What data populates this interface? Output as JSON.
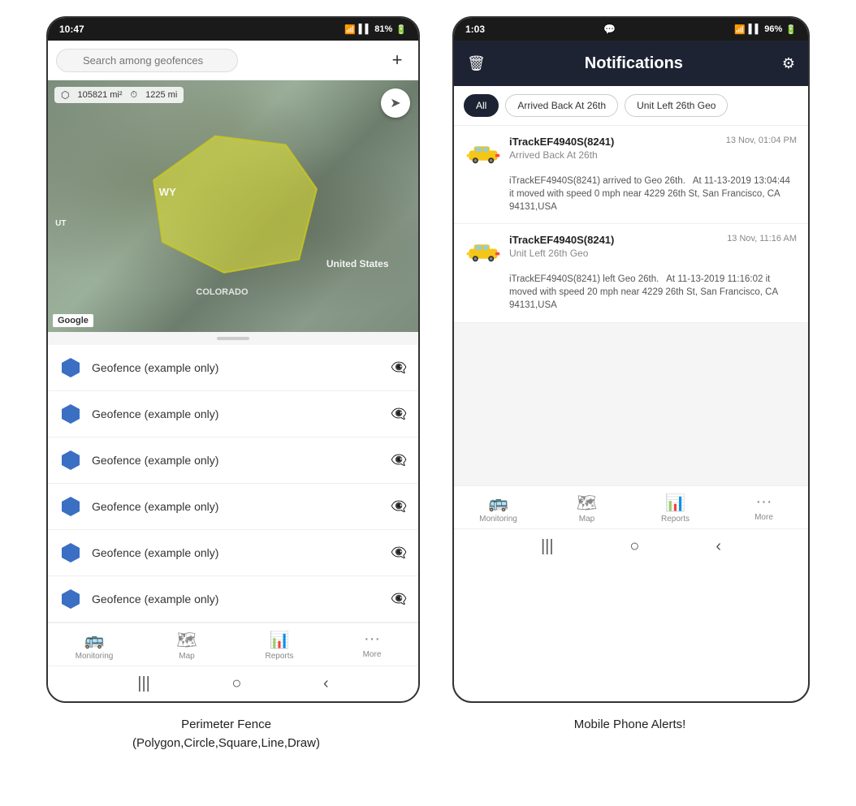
{
  "left_phone": {
    "status_bar": {
      "time": "10:47",
      "signal": "WiFi",
      "battery": "81%"
    },
    "search": {
      "placeholder": "Search among geofences"
    },
    "map": {
      "area_label": "105821 mi²",
      "distance_label": "1225 mi",
      "state_label": "WY",
      "country_label": "United States",
      "region_label": "COLORADO",
      "territory": "UT"
    },
    "geofence_list": [
      {
        "label": "Geofence (example only)"
      },
      {
        "label": "Geofence (example only)"
      },
      {
        "label": "Geofence (example only)"
      },
      {
        "label": "Geofence (example only)"
      },
      {
        "label": "Geofence (example only)"
      },
      {
        "label": "Geofence (example only)"
      }
    ],
    "bottom_nav": [
      {
        "icon": "🚌",
        "label": "Monitoring"
      },
      {
        "icon": "🗺",
        "label": "Map"
      },
      {
        "icon": "📊",
        "label": "Reports"
      },
      {
        "icon": "···",
        "label": "More"
      }
    ],
    "android_nav": [
      "|||",
      "○",
      "<"
    ]
  },
  "right_phone": {
    "status_bar": {
      "time": "1:03",
      "battery": "96%"
    },
    "header": {
      "title": "Notifications",
      "delete_icon": "🗑",
      "settings_icon": "⚙"
    },
    "filter_tabs": [
      {
        "label": "All",
        "active": true
      },
      {
        "label": "Arrived Back At 26th",
        "active": false
      },
      {
        "label": "Unit Left 26th Geo",
        "active": false
      }
    ],
    "notifications": [
      {
        "device": "iTrackEF4940S(8241)",
        "time": "13 Nov, 01:04 PM",
        "event": "Arrived Back At 26th",
        "body": "iTrackEF4940S(8241) arrived to Geo 26th.   At 11-13-2019 13:04:44 it moved with speed 0 mph near 4229 26th St, San Francisco, CA 94131,USA"
      },
      {
        "device": "iTrackEF4940S(8241)",
        "time": "13 Nov, 11:16 AM",
        "event": "Unit Left 26th Geo",
        "body": "iTrackEF4940S(8241) left Geo 26th.   At 11-13-2019 11:16:02 it moved with speed 20 mph near 4229 26th St, San Francisco, CA 94131,USA"
      }
    ],
    "bottom_nav": [
      {
        "icon": "🚌",
        "label": "Monitoring"
      },
      {
        "icon": "🗺",
        "label": "Map"
      },
      {
        "icon": "📊",
        "label": "Reports"
      },
      {
        "icon": "···",
        "label": "More"
      }
    ],
    "android_nav": [
      "|||",
      "○",
      "<"
    ]
  },
  "captions": {
    "left": "Perimeter Fence\n(Polygon,Circle,Square,Line,Draw)",
    "right": "Mobile Phone Alerts!"
  }
}
